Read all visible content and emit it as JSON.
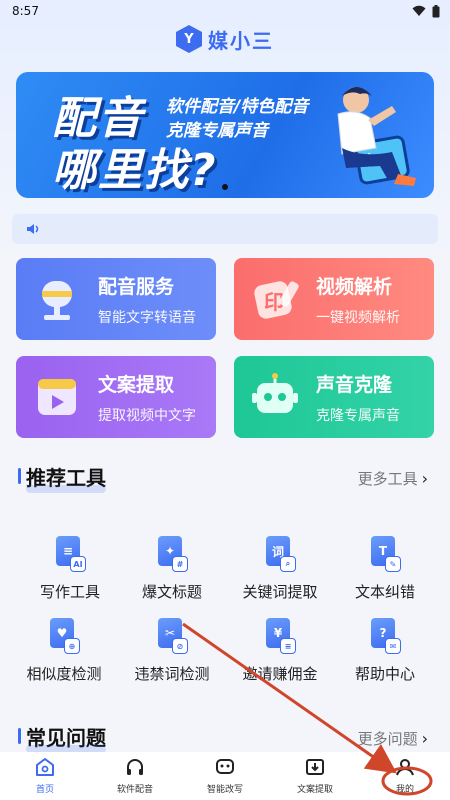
{
  "status": {
    "time": "8:57"
  },
  "app": {
    "logo_glyph": "Y",
    "logo_text": "媒小三"
  },
  "banner": {
    "headline_1": "配音",
    "headline_2": "哪里找?",
    "sub_1": "软件配音/特色配音",
    "sub_2": "克隆专属声音"
  },
  "services": [
    {
      "title": "配音服务",
      "desc": "智能文字转语音",
      "icon": "microphone-icon"
    },
    {
      "title": "视频解析",
      "desc": "一键视频解析",
      "icon": "stamp-icon",
      "badge": "印"
    },
    {
      "title": "文案提取",
      "desc": "提取视频中文字",
      "icon": "video-player-icon"
    },
    {
      "title": "声音克隆",
      "desc": "克隆专属声音",
      "icon": "robot-icon"
    }
  ],
  "recommended": {
    "title": "推荐工具",
    "more": "更多工具",
    "tools": [
      {
        "label": "写作工具",
        "glyph": "≡",
        "badge": "AI"
      },
      {
        "label": "爆文标题",
        "glyph": "✦",
        "badge": "#"
      },
      {
        "label": "关键词提取",
        "glyph": "词",
        "badge": "⌕"
      },
      {
        "label": "文本纠错",
        "glyph": "T",
        "badge": "✎"
      },
      {
        "label": "相似度检测",
        "glyph": "♥",
        "badge": "⊕"
      },
      {
        "label": "违禁词检测",
        "glyph": "✂",
        "badge": "⊘"
      },
      {
        "label": "邀请赚佣金",
        "glyph": "¥",
        "badge": "≡"
      },
      {
        "label": "帮助中心",
        "glyph": "?",
        "badge": "✉"
      }
    ]
  },
  "faq": {
    "title": "常见问题",
    "more": "更多问题"
  },
  "nav": [
    {
      "label": "首页",
      "icon": "home-icon",
      "active": true
    },
    {
      "label": "软件配音",
      "icon": "headphones-icon",
      "active": false
    },
    {
      "label": "智能改写",
      "icon": "robot-face-icon",
      "active": false
    },
    {
      "label": "文案提取",
      "icon": "download-box-icon",
      "active": false
    },
    {
      "label": "我的",
      "icon": "profile-icon",
      "active": false
    }
  ],
  "colors": {
    "accent": "#3d6cf0",
    "annotation": "#d0462a"
  }
}
